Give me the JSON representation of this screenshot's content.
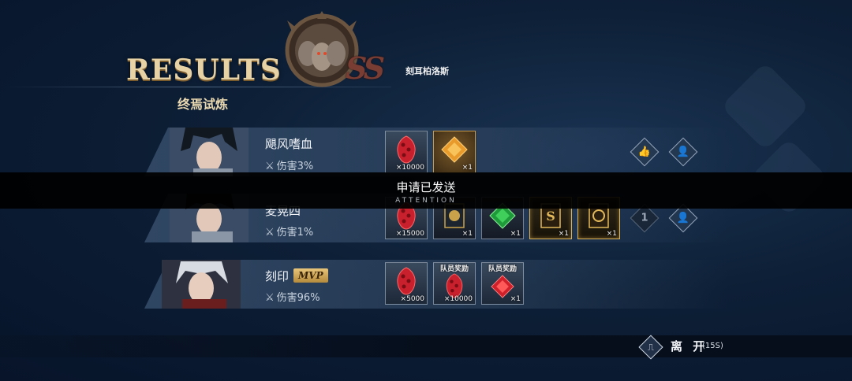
{
  "header": {
    "results_title": "RESULTS",
    "stage_name": "终焉试炼",
    "boss_name": "刻耳柏洛斯",
    "grade": "SS"
  },
  "players": [
    {
      "name": "飓风嗜血",
      "damage": "伤害3%",
      "mvp": false,
      "rewards": [
        {
          "icon": "red-crystal-icon",
          "count": "×10000",
          "tag": ""
        },
        {
          "icon": "orange-diamond-icon",
          "count": "×1",
          "tag": ""
        }
      ],
      "actions": [
        "like-icon",
        "add-friend-icon"
      ]
    },
    {
      "name": "麦晃四",
      "damage": "伤害1%",
      "mvp": false,
      "rewards": [
        {
          "icon": "red-crystal-icon",
          "count": "×15000",
          "tag": ""
        },
        {
          "icon": "dark-card-icon",
          "count": "×1",
          "tag": ""
        },
        {
          "icon": "green-diamond-icon",
          "count": "×1",
          "tag": ""
        },
        {
          "icon": "gold-card-icon",
          "count": "×1",
          "tag": ""
        },
        {
          "icon": "gold-card-icon",
          "count": "×1",
          "tag": ""
        }
      ],
      "like_count": "1",
      "actions": [
        "like-count",
        "add-friend-icon"
      ]
    },
    {
      "name": "刻印",
      "damage": "伤害96%",
      "mvp": true,
      "mvp_label": "MVP",
      "rewards": [
        {
          "icon": "red-crystal-icon",
          "count": "×5000",
          "tag": ""
        },
        {
          "icon": "red-crystal-icon",
          "count": "×10000",
          "tag": "队员奖励"
        },
        {
          "icon": "red-diamond-icon",
          "count": "×1",
          "tag": "队员奖励"
        }
      ]
    }
  ],
  "toast": {
    "message": "申请已发送",
    "sub": "ATTENTION"
  },
  "footer": {
    "leave_label": "离 开",
    "leave_timer": "(15S)"
  },
  "colors": {
    "background": "#0d1f36",
    "title_gold": "#e7d2a6",
    "mvp_gold": "#e8c57a"
  }
}
